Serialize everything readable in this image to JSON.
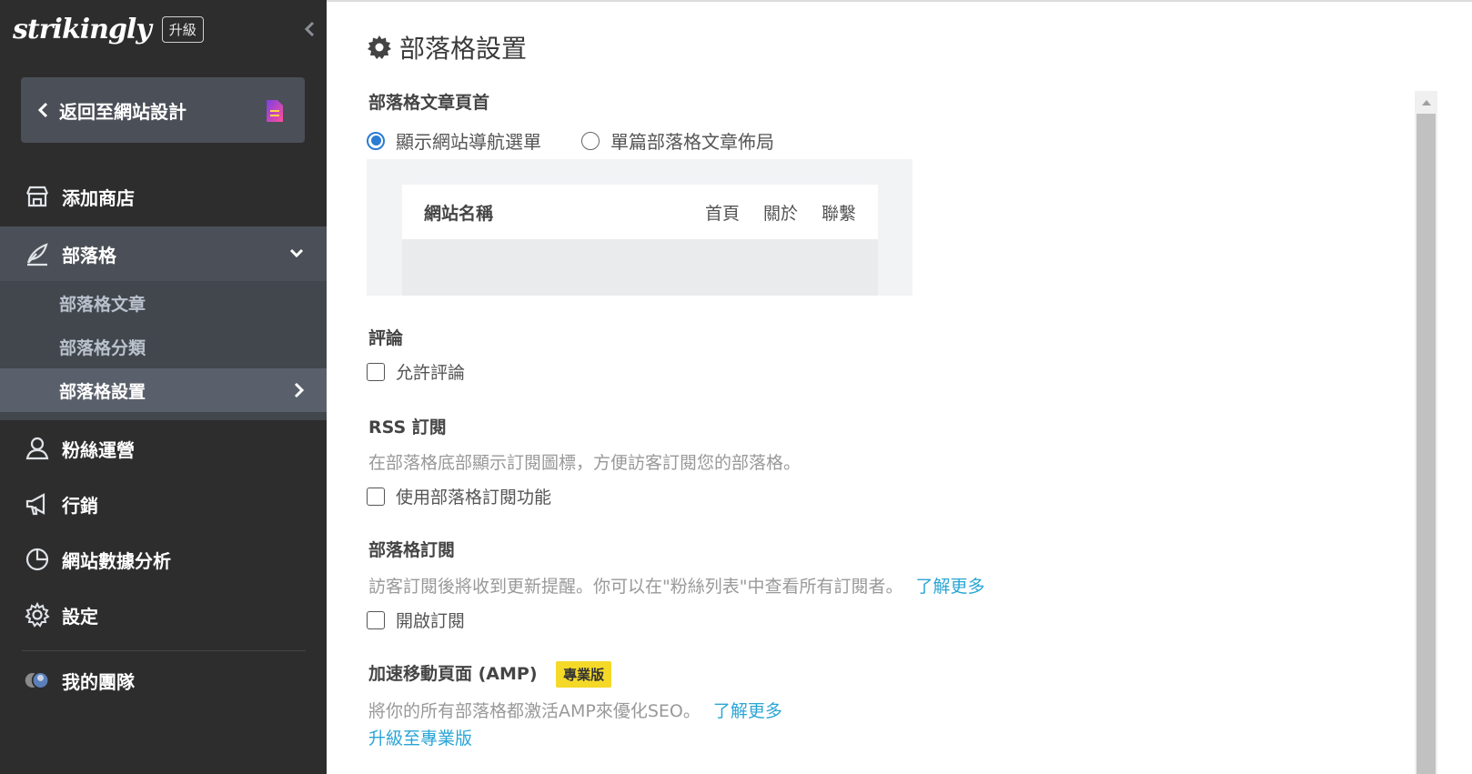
{
  "app": {
    "logo": "strikingly",
    "upgrade_badge": "升級"
  },
  "sidebar": {
    "back_button": "返回至網站設計",
    "items": [
      {
        "label": "添加商店",
        "icon": "store-icon"
      },
      {
        "label": "部落格",
        "icon": "quill-icon"
      },
      {
        "label": "粉絲運營",
        "icon": "users-icon"
      },
      {
        "label": "行銷",
        "icon": "megaphone-icon"
      },
      {
        "label": "網站數據分析",
        "icon": "pie-chart-icon"
      },
      {
        "label": "設定",
        "icon": "gear-icon"
      },
      {
        "label": "我的團隊",
        "icon": "team-avatar"
      }
    ],
    "blog_sub": [
      {
        "label": "部落格文章"
      },
      {
        "label": "部落格分類"
      },
      {
        "label": "部落格設置"
      }
    ]
  },
  "main": {
    "title": "部落格設置",
    "header_section": {
      "title": "部落格文章頁首",
      "option_nav": "顯示網站導航選單",
      "option_single": "單篇部落格文章佈局",
      "selected": "顯示網站導航選單",
      "preview": {
        "site_name": "網站名稱",
        "links": [
          "首頁",
          "關於",
          "聯繫"
        ]
      }
    },
    "comments": {
      "title": "評論",
      "checkbox": "允許評論"
    },
    "rss": {
      "title": "RSS 訂閱",
      "desc": "在部落格底部顯示訂閱圖標，方便訪客訂閱您的部落格。",
      "checkbox": "使用部落格訂閱功能"
    },
    "subscribe": {
      "title": "部落格訂閱",
      "desc": "訪客訂閱後將收到更新提醒。你可以在\"粉絲列表\"中查看所有訂閱者。",
      "learn_more": "了解更多",
      "checkbox": "開啟訂閱"
    },
    "amp": {
      "title": "加速移動頁面 (AMP)",
      "badge": "專業版",
      "desc": "將你的所有部落格都激活AMP來優化SEO。",
      "learn_more": "了解更多",
      "upgrade_link": "升級至專業版"
    }
  },
  "colors": {
    "sidebar_bg": "#2d2d2d",
    "active_bg": "#4b4f57",
    "link": "#2aa6d6",
    "radio": "#2a7cd4",
    "pro_badge": "#f5d928"
  }
}
